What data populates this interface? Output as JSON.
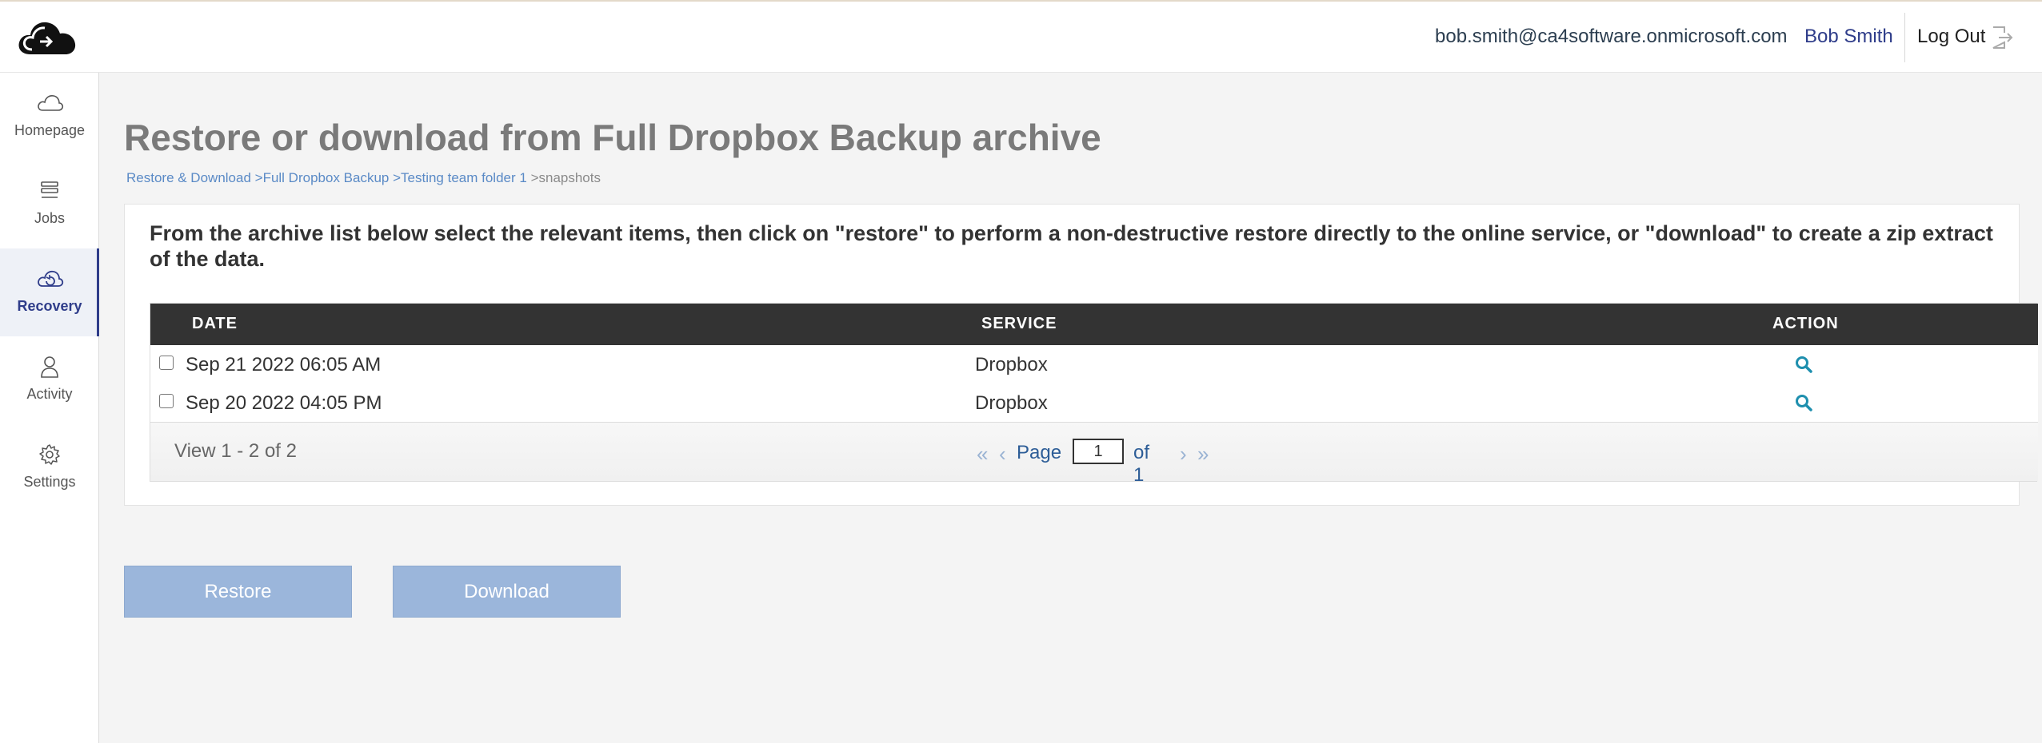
{
  "header": {
    "user_email": "bob.smith@ca4software.onmicrosoft.com",
    "user_name": "Bob Smith",
    "logout_label": "Log Out"
  },
  "sidebar": {
    "items": [
      {
        "label": "Homepage",
        "icon": "cloud-icon"
      },
      {
        "label": "Jobs",
        "icon": "server-stack-icon"
      },
      {
        "label": "Recovery",
        "icon": "cloud-restore-icon",
        "active": true
      },
      {
        "label": "Activity",
        "icon": "user-icon"
      },
      {
        "label": "Settings",
        "icon": "gear-icon"
      }
    ]
  },
  "main": {
    "title": "Restore or download from Full Dropbox Backup archive",
    "breadcrumb": [
      "Restore & Download ",
      ">Full Dropbox Backup ",
      ">Testing team folder 1 ",
      ">snapshots"
    ],
    "instructions": "From the archive list below select the relevant items, then click on \"restore\" to perform a non-destructive restore directly to the online service, or \"download\" to create a zip extract of the data.",
    "table": {
      "columns": [
        "DATE",
        "SERVICE",
        "ACTION"
      ],
      "rows": [
        {
          "date": "Sep 21 2022 06:05 AM",
          "service": "Dropbox",
          "checked": false
        },
        {
          "date": "Sep 20 2022 04:05 PM",
          "service": "Dropbox",
          "checked": false
        }
      ]
    },
    "pager": {
      "view_text": "View 1 - 2 of 2",
      "page_label": "Page",
      "page_value": "1",
      "of_text": "of 1"
    },
    "buttons": {
      "restore_label": "Restore",
      "download_label": "Download"
    }
  },
  "colors": {
    "accent": "#2f3d8a",
    "table_header": "#333333",
    "button_disabled": "#9bb6db",
    "link": "#5a8ac6",
    "search_icon": "#1e8fae"
  }
}
